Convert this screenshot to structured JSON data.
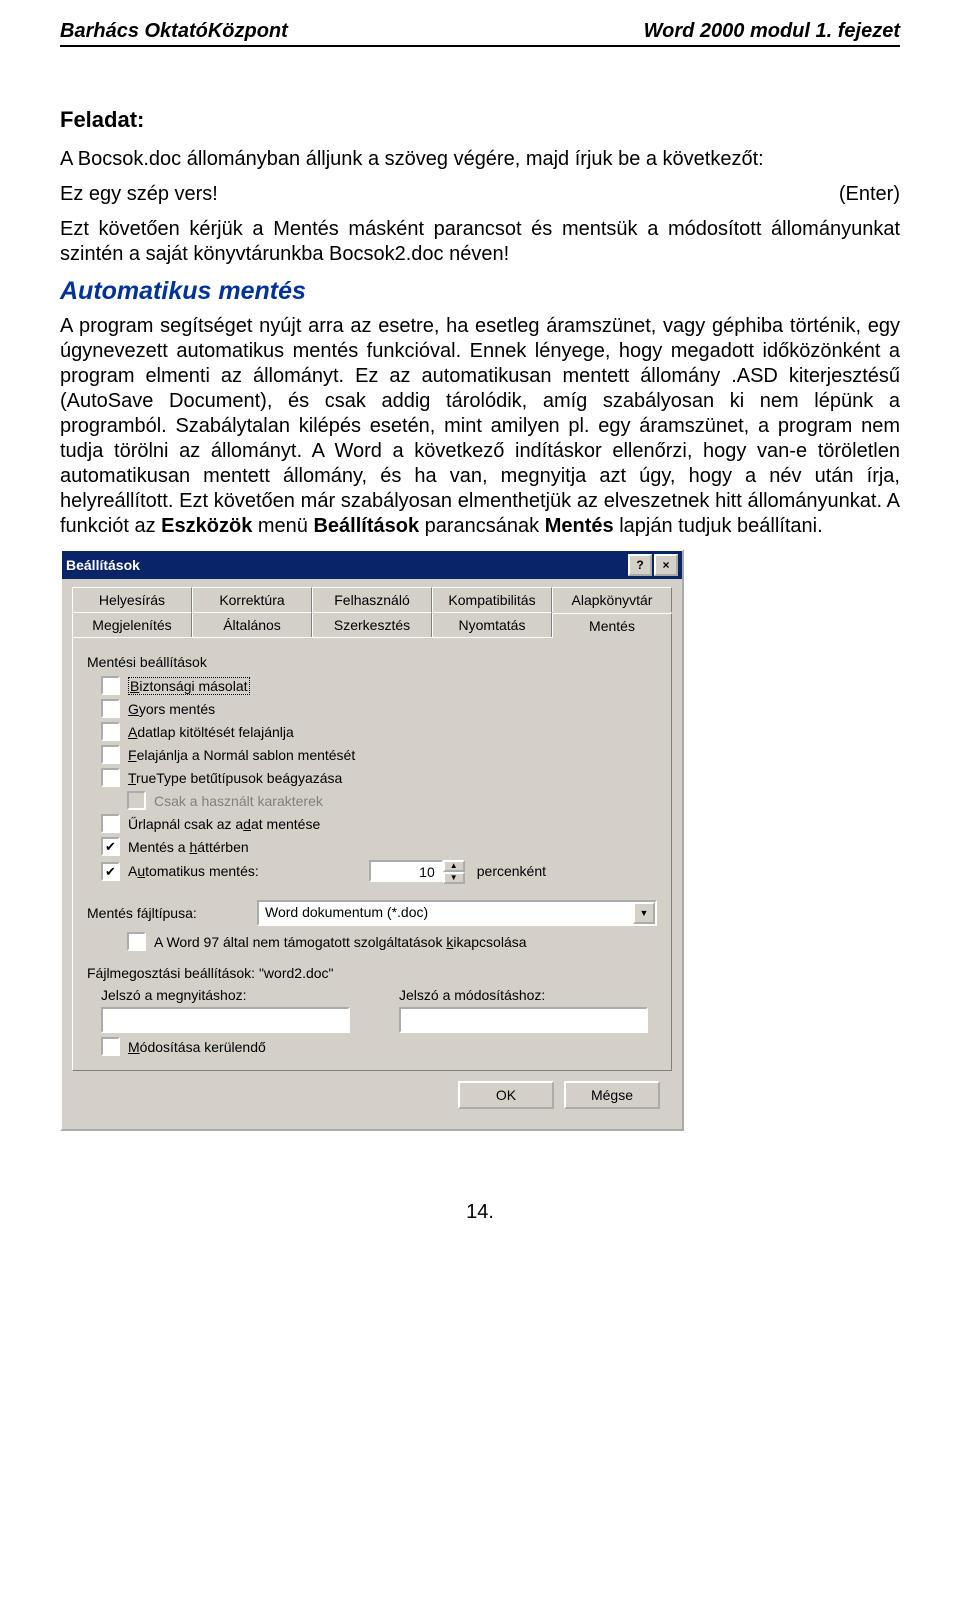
{
  "header": {
    "left": "Barhács OktatóKözpont",
    "right": "Word 2000 modul 1. fejezet"
  },
  "task": {
    "heading": "Feladat:",
    "p1": "A Bocsok.doc állományban álljunk a szöveg végére, majd írjuk be a következőt:",
    "p2a": "Ez egy szép vers!",
    "p2b": "(Enter)",
    "p3": "Ezt követően kérjük a Mentés másként parancsot és mentsük a módosított állományunkat szintén a saját könyvtárunkba Bocsok2.doc néven!"
  },
  "section": {
    "title": "Automatikus mentés",
    "body_pre": "A program segítséget nyújt arra az esetre, ha esetleg áramszünet, vagy géphiba történik, egy úgynevezett automatikus mentés funkcióval. Ennek lényege, hogy megadott időközönként a program elmenti az állományt. Ez az automatikusan mentett állomány .ASD kiterjesztésű (AutoSave Document), és csak addig tárolódik, amíg szabályosan ki nem lépünk a programból. Szabálytalan kilépés esetén, mint amilyen pl. egy áramszünet, a program nem tudja törölni az állományt. A Word a következő indításkor ellenőrzi, hogy van-e töröletlen automatikusan mentett állomány, és ha van, megnyitja azt úgy, hogy a név után írja, helyreállított. Ezt követően már szabályosan elmenthetjük az elveszetnek hitt állományunkat. A funkciót az ",
    "bold1": "Eszközök",
    "mid1": " menü ",
    "bold2": "Beállítások",
    "mid2": " parancsának ",
    "bold3": "Mentés",
    "body_post": " lapján tudjuk beállítani."
  },
  "dialog": {
    "title": "Beállítások",
    "tabs_row1": [
      "Helyesírás",
      "Korrektúra",
      "Felhasználó",
      "Kompatibilitás",
      "Alapkönyvtár"
    ],
    "tabs_row2": [
      "Megjelenítés",
      "Általános",
      "Szerkesztés",
      "Nyomtatás",
      "Mentés"
    ],
    "group1": "Mentési beállítások",
    "checks": [
      {
        "label_pre": "",
        "ul": "B",
        "label_post": "iztonsági másolat",
        "checked": false,
        "dotted": true
      },
      {
        "label_pre": "",
        "ul": "G",
        "label_post": "yors mentés",
        "checked": false
      },
      {
        "label_pre": "",
        "ul": "A",
        "label_post": "datlap kitöltését felajánlja",
        "checked": false
      },
      {
        "label_pre": "",
        "ul": "F",
        "label_post": "elajánlja a Normál sablon mentését",
        "checked": false
      },
      {
        "label_pre": "",
        "ul": "T",
        "label_post": "rueType betűtípusok beágyazása",
        "checked": false
      }
    ],
    "disabled_check": {
      "label": "Csak a használt karakterek"
    },
    "checks2": [
      {
        "label_pre": "Űrlapnál csak az a",
        "ul": "d",
        "label_post": "at mentése",
        "checked": false
      },
      {
        "label_pre": "Mentés a ",
        "ul": "h",
        "label_post": "áttérben",
        "checked": true
      }
    ],
    "auto": {
      "label_pre": "A",
      "ul": "u",
      "label_post": "tomatikus mentés:",
      "checked": true,
      "value": "10",
      "suffix": "percenként"
    },
    "filetype": {
      "label_pre": "Me",
      "ul": "n",
      "label_post": "tés fájltípusa:",
      "value": "Word dokumentum (*.doc)"
    },
    "w97": {
      "label_pre": "A Word 97 által nem támogatott szolgáltatások ",
      "ul": "k",
      "label_post": "ikapcsolása",
      "checked": false
    },
    "share_label": "Fájlmegosztási beállítások: \"word2.doc\"",
    "pw_open": {
      "pre": "",
      "ul": "J",
      "post": "elszó a megnyitáshoz:"
    },
    "pw_mod": {
      "pre": "Jelszó a mó",
      "ul": "d",
      "post": "osításhoz:"
    },
    "readonly": {
      "pre": "",
      "ul": "M",
      "post": "ódosítása kerülendő",
      "checked": false
    },
    "ok": "OK",
    "cancel_pre": "Mé",
    "cancel_ul": "g",
    "cancel_post": "se"
  },
  "pagenum": "14."
}
